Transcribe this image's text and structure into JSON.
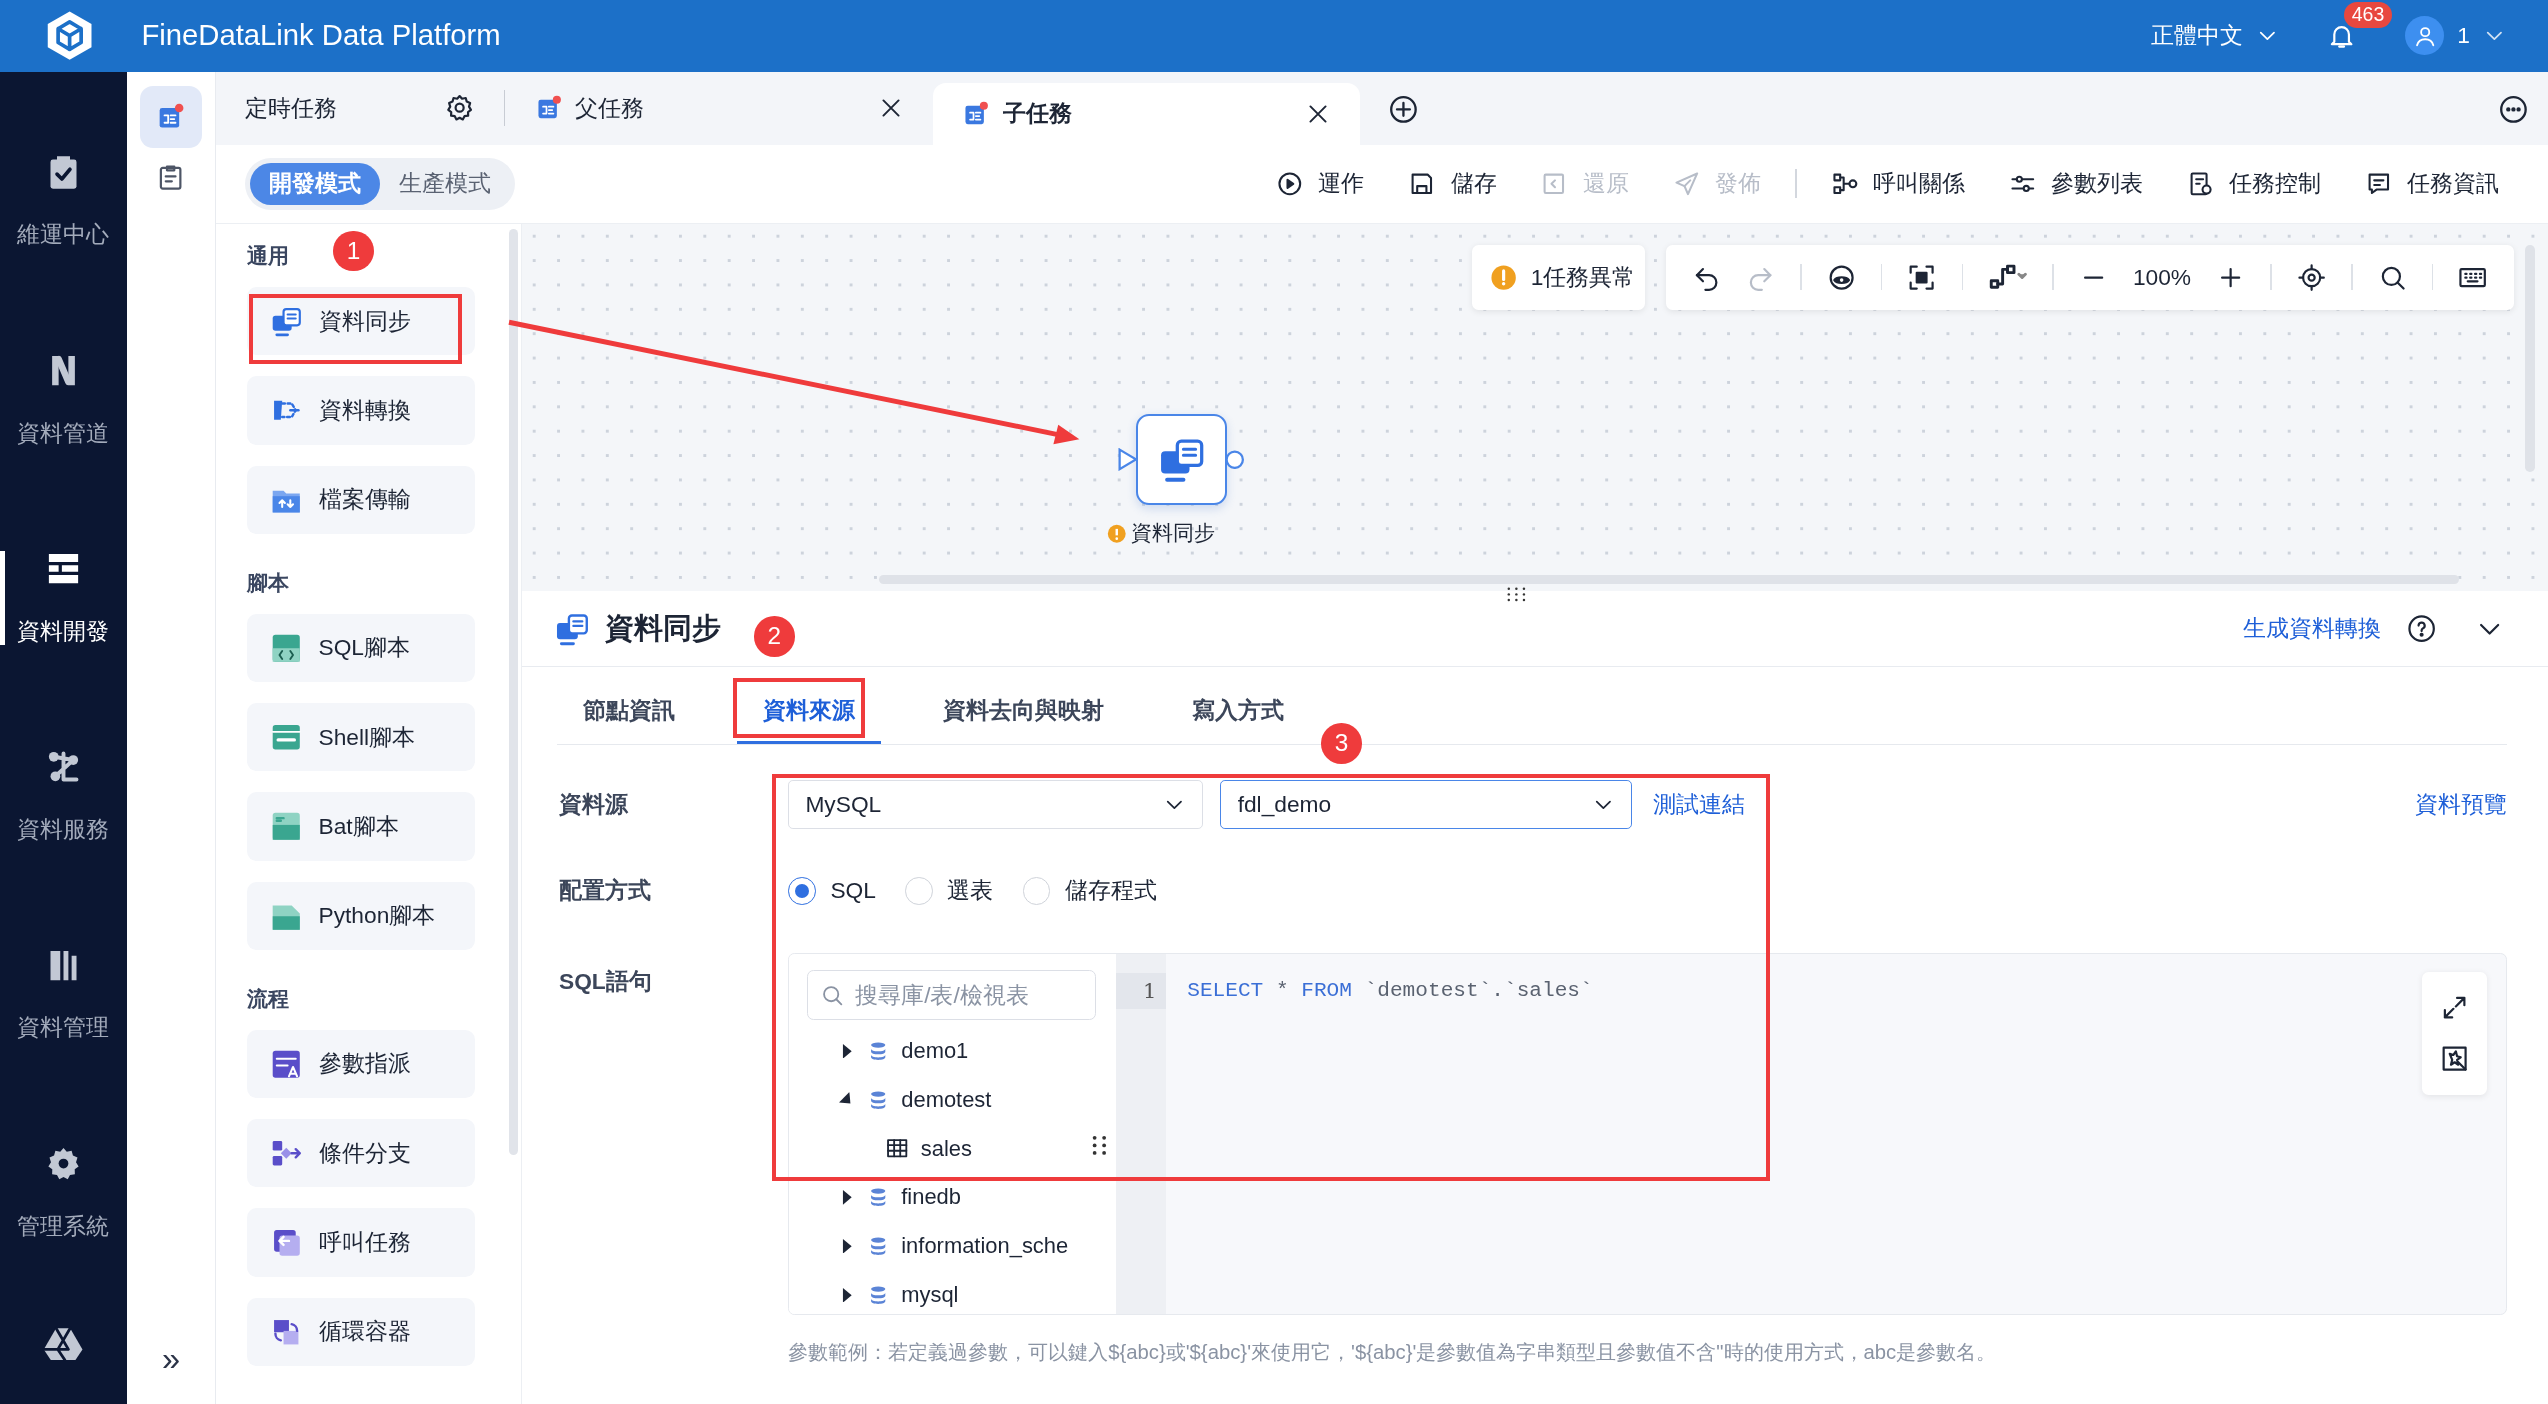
{
  "header": {
    "title": "FineDataLink Data Platform",
    "language": "正體中文",
    "notifications": "463",
    "user": "1"
  },
  "nav": [
    {
      "label": "維運中心",
      "selected": false
    },
    {
      "label": "資料管道",
      "selected": false
    },
    {
      "label": "資料開發",
      "selected": true
    },
    {
      "label": "資料服務",
      "selected": false
    },
    {
      "label": "資料管理",
      "selected": false
    },
    {
      "label": "管理系統",
      "selected": false
    }
  ],
  "side_panel": {
    "collapse": "»"
  },
  "tabs": [
    {
      "label": "定時任務",
      "kind": "schedule",
      "selected": false
    },
    {
      "label": "父任務",
      "kind": "task",
      "selected": false
    },
    {
      "label": "子任務",
      "kind": "task",
      "selected": true
    }
  ],
  "modes": [
    {
      "label": "開發模式",
      "selected": true
    },
    {
      "label": "生產模式",
      "selected": false
    }
  ],
  "actions": [
    {
      "label": "運作",
      "disabled": false
    },
    {
      "label": "儲存",
      "disabled": false
    },
    {
      "label": "還原",
      "disabled": true
    },
    {
      "label": "發佈",
      "disabled": true
    },
    {
      "label": "呼叫關係",
      "disabled": false
    },
    {
      "label": "參數列表",
      "disabled": false
    },
    {
      "label": "任務控制",
      "disabled": false
    },
    {
      "label": "任務資訊",
      "disabled": false
    }
  ],
  "palette": [
    {
      "title": "通用",
      "items": [
        "資料同步",
        "資料轉換",
        "檔案傳輸"
      ]
    },
    {
      "title": "腳本",
      "items": [
        "SQL腳本",
        "Shell腳本",
        "Bat腳本",
        "Python腳本"
      ]
    },
    {
      "title": "流程",
      "items": [
        "參數指派",
        "條件分支",
        "呼叫任務",
        "循環容器"
      ]
    }
  ],
  "canvas": {
    "alert": "1任務異常",
    "zoom": "100%",
    "node": {
      "label": "資料同步",
      "warning": true
    }
  },
  "panel": {
    "title": "資料同步",
    "link": "生成資料轉換",
    "tabs": [
      {
        "label": "節點資訊",
        "selected": false
      },
      {
        "label": "資料來源",
        "selected": true
      },
      {
        "label": "資料去向與映射",
        "selected": false
      },
      {
        "label": "寫入方式",
        "selected": false
      }
    ],
    "source_label": "資料源",
    "source_type": "MySQL",
    "connection": "fdl_demo",
    "test_link": "測試連結",
    "preview_link": "資料預覽",
    "config_label": "配置方式",
    "options": [
      {
        "label": "SQL",
        "selected": true
      },
      {
        "label": "選表",
        "selected": false
      },
      {
        "label": "儲存程式",
        "selected": false
      }
    ],
    "sql_label": "SQL語句",
    "search_placeholder": "搜尋庫/表/檢視表",
    "tree": [
      {
        "label": "demo1",
        "kind": "database",
        "expanded": false
      },
      {
        "label": "demotest",
        "kind": "database",
        "expanded": true,
        "children": [
          {
            "label": "sales",
            "kind": "table"
          }
        ]
      },
      {
        "label": "finedb",
        "kind": "database",
        "expanded": false
      },
      {
        "label": "information_sche",
        "kind": "database",
        "expanded": false
      },
      {
        "label": "mysql",
        "kind": "database",
        "expanded": false
      }
    ],
    "line_numbers": [
      "1"
    ],
    "sql": [
      {
        "text": "SELECT",
        "kind": "keyword"
      },
      {
        "text": " * ",
        "kind": "plain"
      },
      {
        "text": "FROM",
        "kind": "keyword"
      },
      {
        "text": " `demotest`.`sales`",
        "kind": "plain"
      }
    ],
    "hint": "參數範例：若定義過參數，可以鍵入${abc}或'${abc}'來使用它，'${abc}'是參數值為字串類型且參數值不含\"時的使用方式，abc是參數名。"
  },
  "annotations": [
    {
      "label": "1"
    },
    {
      "label": "2"
    },
    {
      "label": "3"
    }
  ]
}
